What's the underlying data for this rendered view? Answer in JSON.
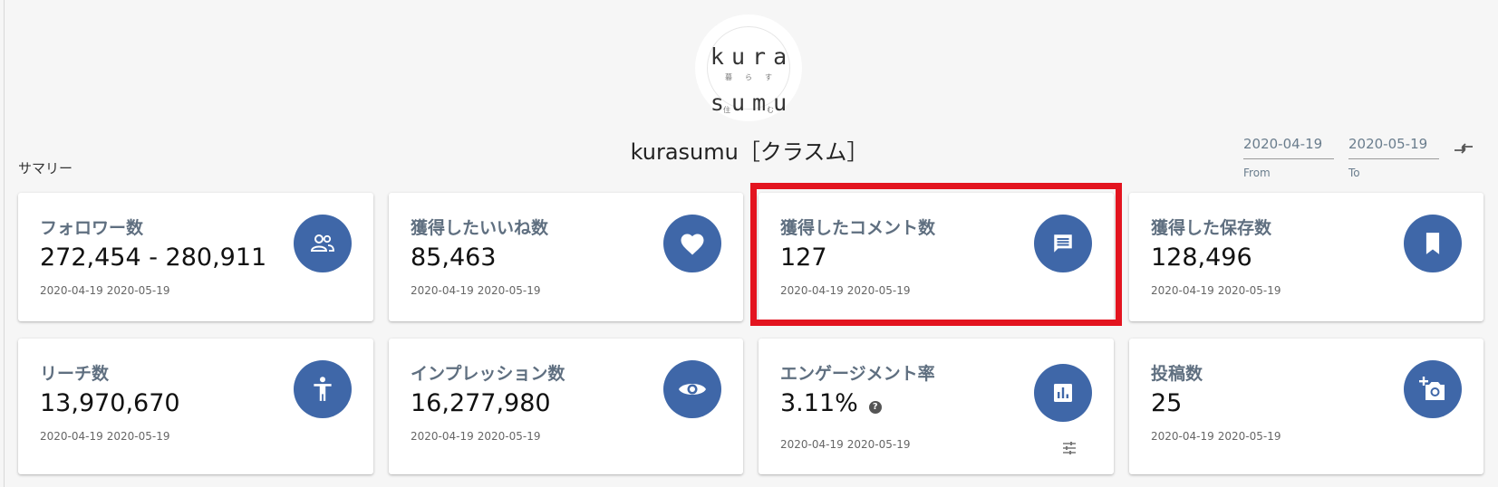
{
  "profile": {
    "logo": {
      "row1": [
        "k",
        "u",
        "r",
        "a"
      ],
      "row2": [
        "暮",
        "ら",
        "す"
      ],
      "row3": [
        "s",
        "u",
        "m",
        "u"
      ],
      "row4": [
        "住",
        "む"
      ]
    },
    "name": "kurasumu［クラスム］"
  },
  "summary": {
    "title": "サマリー"
  },
  "date_range": {
    "from_value": "2020-04-19",
    "from_label": "From",
    "to_value": "2020-05-19",
    "to_label": "To",
    "swap_icon": "compare-arrows-icon"
  },
  "cards": [
    {
      "title": "フォロワー数",
      "value": "272,454 - 280,911",
      "date_from": "2020-04-19",
      "date_to": "2020-05-19",
      "icon": "people-icon"
    },
    {
      "title": "獲得したいいね数",
      "value": "85,463",
      "date_from": "2020-04-19",
      "date_to": "2020-05-19",
      "icon": "heart-icon"
    },
    {
      "title": "獲得したコメント数",
      "value": "127",
      "date_from": "2020-04-19",
      "date_to": "2020-05-19",
      "icon": "comment-icon",
      "highlighted": true
    },
    {
      "title": "獲得した保存数",
      "value": "128,496",
      "date_from": "2020-04-19",
      "date_to": "2020-05-19",
      "icon": "bookmark-icon"
    },
    {
      "title": "リーチ数",
      "value": "13,970,670",
      "date_from": "2020-04-19",
      "date_to": "2020-05-19",
      "icon": "accessibility-icon"
    },
    {
      "title": "インプレッション数",
      "value": "16,277,980",
      "date_from": "2020-04-19",
      "date_to": "2020-05-19",
      "icon": "eye-icon"
    },
    {
      "title": "エンゲージメント率",
      "value": "3.11%",
      "date_from": "2020-04-19",
      "date_to": "2020-05-19",
      "icon": "bar-chart-icon",
      "extra_icons": [
        "help-icon",
        "tune-icon"
      ]
    },
    {
      "title": "投稿数",
      "value": "25",
      "date_from": "2020-04-19",
      "date_to": "2020-05-19",
      "icon": "add-photo-icon"
    }
  ],
  "colors": {
    "icon_circle": "#3f67a8",
    "card_title": "#5f6f80",
    "highlight": "#e3141f",
    "background": "#f6f6f6"
  }
}
